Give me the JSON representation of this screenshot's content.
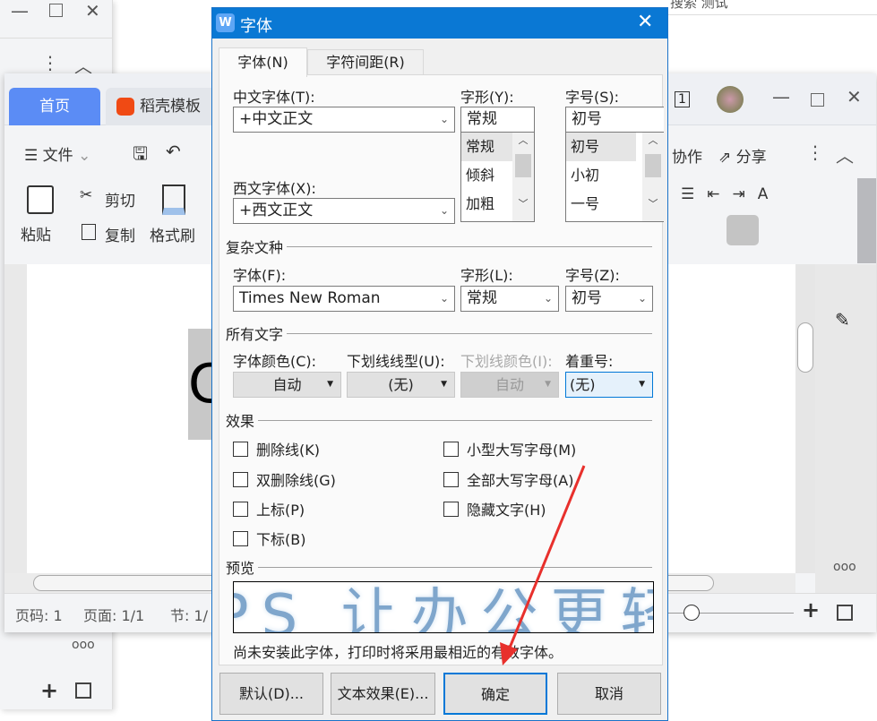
{
  "back_window": {
    "search_text": "搜索 测试"
  },
  "main_window": {
    "tabs": [
      {
        "label": "首页"
      },
      {
        "label": "稻壳模板"
      }
    ],
    "toolbar": {
      "file_menu": "文件",
      "collab": "协作",
      "share": "分享"
    },
    "ribbon": {
      "cut": "剪切",
      "copy": "复制",
      "paste": "粘贴",
      "format_painter": "格式刷"
    },
    "page_badge": "1",
    "doc_text": "C",
    "status": {
      "page_no": "页码: 1",
      "pages": "页面: 1/1",
      "section": "节: 1/"
    }
  },
  "dialog": {
    "title": "字体",
    "tabs": [
      {
        "label": "字体(N)",
        "key": "N"
      },
      {
        "label": "字符间距(R)",
        "key": "R"
      }
    ],
    "cn_font_label": "中文字体(T):",
    "cn_font": "+中文正文",
    "west_font_label": "西文字体(X):",
    "west_font": "+西文正文",
    "style_label": "字形(Y):",
    "style_value": "常规",
    "style_options": [
      "常规",
      "倾斜",
      "加粗"
    ],
    "size_label": "字号(S):",
    "size_value": "初号",
    "size_options": [
      "初号",
      "小初",
      "一号"
    ],
    "complex_section": "复杂文种",
    "complex_font_label": "字体(F):",
    "complex_font": "Times New Roman",
    "complex_style_label": "字形(L):",
    "complex_style": "常规",
    "complex_size_label": "字号(Z):",
    "complex_size": "初号",
    "all_text_section": "所有文字",
    "font_color_label": "字体颜色(C):",
    "font_color": "自动",
    "underline_type_label": "下划线线型(U):",
    "underline_type": "(无)",
    "underline_color_label": "下划线颜色(I):",
    "underline_color": "自动",
    "emphasis_label": "着重号:",
    "emphasis": "(无)",
    "effects_section": "效果",
    "effects": [
      {
        "label": "删除线(K)",
        "checked": false
      },
      {
        "label": "双删除线(G)",
        "checked": false
      },
      {
        "label": "上标(P)",
        "checked": false
      },
      {
        "label": "下标(B)",
        "checked": false
      },
      {
        "label": "小型大写字母(M)",
        "checked": false
      },
      {
        "label": "全部大写字母(A)",
        "checked": false
      },
      {
        "label": "隐藏文字(H)",
        "checked": false
      }
    ],
    "preview_section": "预览",
    "preview_text": "PS 让办公更轻",
    "note": "尚未安装此字体，打印时将采用最相近的有效字体。",
    "buttons": {
      "default": "默认(D)...",
      "text_effect": "文本效果(E)...",
      "ok": "确定",
      "cancel": "取消"
    }
  },
  "colors": {
    "title_bar": "#0a78d4",
    "home_tab": "#5b8cf5",
    "arrow": "#e8302c"
  }
}
